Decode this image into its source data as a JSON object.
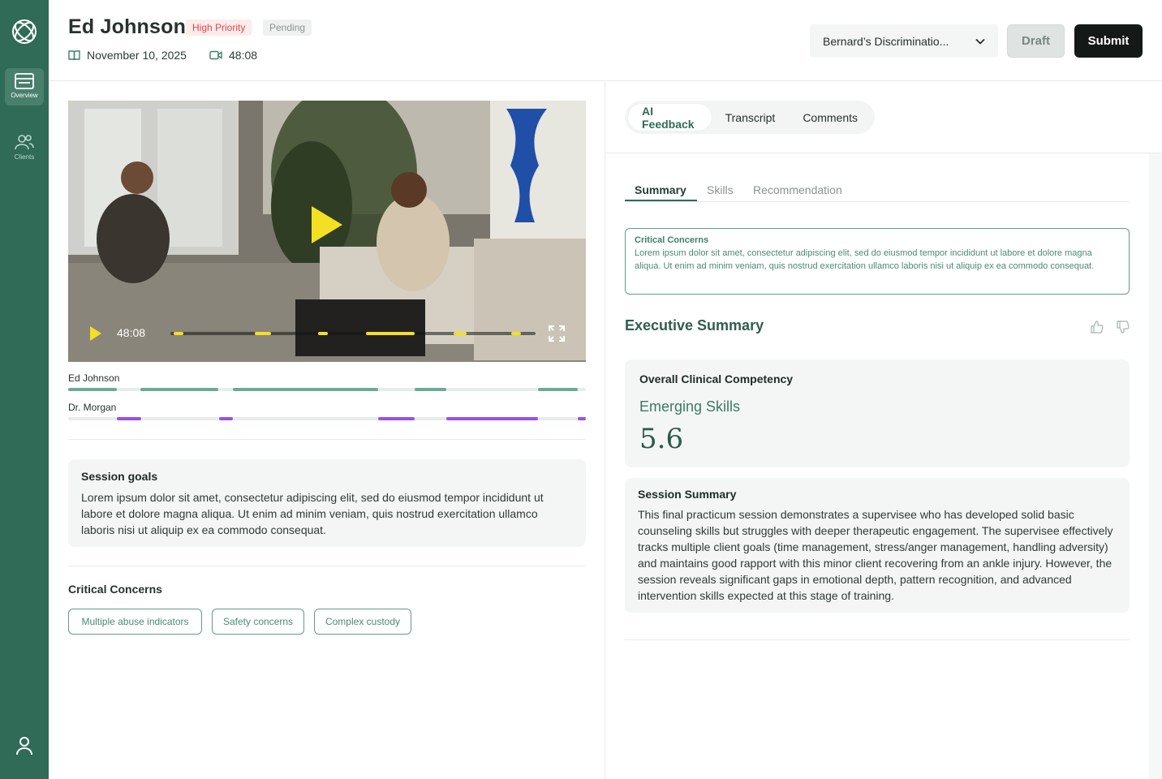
{
  "colors": {
    "brand": "#2f6b57",
    "priority": "#e04848",
    "video_progress": "#f3e024",
    "speaker_client": "#6aab93",
    "speaker_counselor": "#9b4fe6"
  },
  "sidebar": {
    "items": [
      {
        "label": "Overview",
        "icon": "overview-icon",
        "active": true
      },
      {
        "label": "Clients",
        "icon": "clients-icon",
        "active": false
      }
    ]
  },
  "header": {
    "client_name": "Ed Johnson",
    "priority_badge": "High Priority",
    "status_badge": "Pending",
    "date": "November 10, 2025",
    "duration": "48:08",
    "rubric_select": "Bernard’s Discriminatio...",
    "draft_label": "Draft",
    "submit_label": "Submit"
  },
  "video": {
    "time": "48:08"
  },
  "speakers": [
    {
      "name": "Ed Johnson"
    },
    {
      "name": "Dr. Morgan"
    }
  ],
  "session_goals": {
    "title": "Session goals",
    "text": "Lorem ipsum dolor sit amet, consectetur adipiscing elit, sed do eiusmod tempor incididunt ut labore et dolore magna aliqua. Ut enim ad minim veniam, quis nostrud exercitation ullamco laboris nisi ut aliquip ex ea commodo consequat."
  },
  "critical_concerns": {
    "title": "Critical Concerns",
    "chips": [
      "Multiple abuse indicators",
      "Safety concerns",
      "Complex custody"
    ]
  },
  "right": {
    "tabs": [
      "AI Feedback",
      "Transcript",
      "Comments"
    ],
    "sub_tabs": [
      "Summary",
      "Skills",
      "Recommendation"
    ],
    "cc_box": {
      "title": "Critical Concerns",
      "text": "Lorem ipsum dolor sit amet, consectetur adipiscing elit, sed do eiusmod  tempor incididunt ut labore et dolore magna aliqua. Ut enim ad minim  veniam, quis nostrud exercitation ullamco laboris nisi ut aliquip ex ea  commodo consequat."
    },
    "exec_title": "Executive Summary",
    "competency": {
      "label": "Overall Clinical Competency",
      "level": "Emerging Skills",
      "score": "5.6"
    },
    "session_summary": {
      "title": "Session Summary",
      "text": "This final practicum session demonstrates a supervisee who has developed solid basic counseling skills but struggles with deeper therapeutic engagement. The supervisee effectively tracks multiple client goals (time management, stress/anger management, handling adversity) and maintains good rapport with this minor client recovering from an ankle injury. However, the session reveals significant gaps in emotional depth, pattern recognition, and advanced intervention skills expected at this stage of training."
    }
  }
}
